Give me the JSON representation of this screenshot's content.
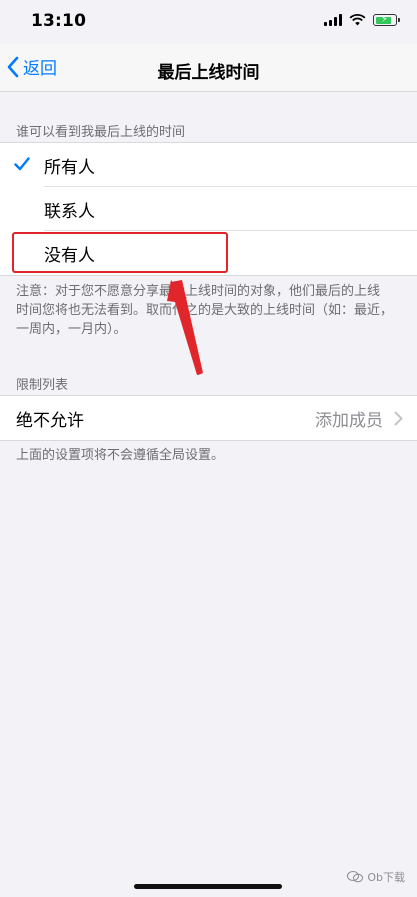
{
  "status_bar": {
    "time": "13:10"
  },
  "nav": {
    "back_label": "返回",
    "title": "最后上线时间"
  },
  "visibility": {
    "header": "谁可以看到我最后上线的时间",
    "options": [
      {
        "label": "所有人",
        "selected": true
      },
      {
        "label": "联系人",
        "selected": false
      },
      {
        "label": "没有人",
        "selected": false
      }
    ],
    "note_line1": "注意：对于您不愿意分享最后上线时间的对象，他们最后的上线",
    "note_line2": "时间您将也无法看到。取而代之的是大致的上线时间（如：最近，",
    "note_line3": "一周内，一月内）。"
  },
  "restriction": {
    "header": "限制列表",
    "row_label": "绝不允许",
    "row_value": "添加成员",
    "footer": "上面的设置项将不会遵循全局设置。"
  },
  "watermark": {
    "text": "Ob下载"
  },
  "colors": {
    "accent": "#007aff",
    "highlight": "#e0262b",
    "battery": "#34c759"
  },
  "icons": [
    "check-icon",
    "back-chevron-icon",
    "chevron-right-icon",
    "wifi-icon",
    "battery-icon"
  ]
}
